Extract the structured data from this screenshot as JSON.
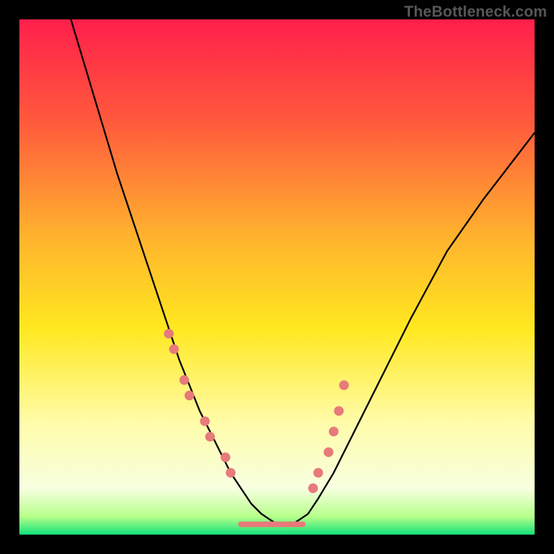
{
  "watermark": "TheBottleneck.com",
  "chart_data": {
    "type": "line",
    "title": "",
    "xlabel": "",
    "ylabel": "",
    "xlim": [
      0,
      100
    ],
    "ylim": [
      0,
      100
    ],
    "grid": false,
    "legend": false,
    "gradient_stops": [
      {
        "offset": 0.0,
        "color": "#ff1f4b"
      },
      {
        "offset": 0.2,
        "color": "#ff5a3c"
      },
      {
        "offset": 0.42,
        "color": "#ffb22e"
      },
      {
        "offset": 0.6,
        "color": "#ffe81f"
      },
      {
        "offset": 0.78,
        "color": "#fffca8"
      },
      {
        "offset": 0.91,
        "color": "#f7ffe0"
      },
      {
        "offset": 0.965,
        "color": "#b7ff8a"
      },
      {
        "offset": 1.0,
        "color": "#11e27a"
      }
    ],
    "series": [
      {
        "name": "curve",
        "type": "line",
        "stroke": "#000000",
        "x": [
          10,
          13,
          16,
          19,
          22,
          25,
          27,
          29,
          31,
          33,
          35,
          37,
          39,
          41,
          43,
          45,
          47,
          50,
          53,
          56,
          58,
          61,
          65,
          70,
          76,
          83,
          90,
          100
        ],
        "y": [
          100,
          90,
          80,
          70,
          61,
          52,
          46,
          40,
          34,
          29,
          24,
          20,
          16,
          12,
          9,
          6,
          4,
          2,
          2,
          4,
          7,
          12,
          20,
          30,
          42,
          55,
          65,
          78
        ]
      },
      {
        "name": "markers-left",
        "type": "scatter",
        "color": "#e77a7a",
        "x": [
          29,
          30,
          32,
          33,
          36,
          37,
          40,
          41
        ],
        "y": [
          39,
          36,
          30,
          27,
          22,
          19,
          15,
          12
        ]
      },
      {
        "name": "markers-right",
        "type": "scatter",
        "color": "#e77a7a",
        "x": [
          57,
          58,
          60,
          61,
          62,
          63
        ],
        "y": [
          9,
          12,
          16,
          20,
          24,
          29
        ]
      },
      {
        "name": "bottom-bar",
        "type": "line",
        "stroke": "#e77a7a",
        "stroke_width": 8,
        "x": [
          43,
          55
        ],
        "y": [
          2,
          2
        ]
      }
    ]
  }
}
